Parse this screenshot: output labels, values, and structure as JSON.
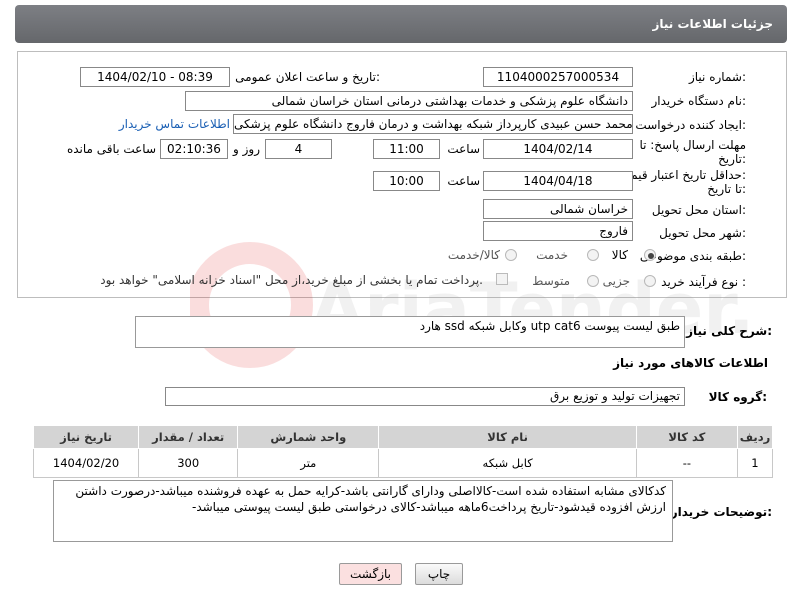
{
  "header": {
    "title": "جزئیات اطلاعات نیاز"
  },
  "fields": {
    "need_number_label": "شماره نیاز:",
    "need_number": "1104000257000534",
    "announce_label": "تاریخ و ساعت اعلان عمومی:",
    "announce_value": "1404/02/10 - 08:39",
    "buyer_org_label": "نام دستگاه خریدار:",
    "buyer_org": "دانشگاه علوم پزشکی و خدمات بهداشتی درمانی استان خراسان شمالی",
    "creator_label": "ایجاد کننده درخواست:",
    "creator": "محمد حسن عبیدی کارپرداز شبکه بهداشت و درمان فاروج دانشگاه علوم پزشکی",
    "contact_link": "اطلاعات تماس خریدار",
    "deadline_label_1": "مهلت ارسال پاسخ: تا",
    "deadline_label_2": "تاریخ:",
    "deadline_date": "1404/02/14",
    "time_label": "ساعت",
    "deadline_time": "11:00",
    "days_value": "4",
    "days_label": "روز و",
    "remaining_time": "02:10:36",
    "remaining_label": "ساعت باقی مانده",
    "min_price_label_1": "حداقل تاریخ اعتبار قیمت:",
    "min_price_label_2": "تا تاریخ:",
    "min_price_date": "1404/04/18",
    "min_price_time": "10:00",
    "province_label": "استان محل تحویل:",
    "province": "خراسان شمالی",
    "city_label": "شهر محل تحویل:",
    "city": "فاروج",
    "category_label": "طبقه بندی موضوعی:",
    "category_options": [
      "کالا",
      "خدمت",
      "کالا/خدمت"
    ],
    "purchase_type_label": "نوع فرآیند خرید :",
    "purchase_options": [
      "جزیی",
      "متوسط"
    ],
    "payment_note": "پرداخت تمام یا بخشی از مبلغ خرید،از محل \"اسناد خزانه اسلامی\" خواهد بود."
  },
  "description": {
    "label": "شرح کلی نیاز:",
    "text": "هارد ssd وکابل شبکه utp cat6 طبق لیست پیوست"
  },
  "goods": {
    "section_title": "اطلاعات کالاهای مورد نیاز",
    "group_label": "گروه کالا:",
    "group_value": "تجهیزات تولید و توزیع برق",
    "columns": [
      "ردیف",
      "کد کالا",
      "نام کالا",
      "واحد شمارش",
      "تعداد / مقدار",
      "تاریخ نیاز"
    ],
    "rows": [
      {
        "row": "1",
        "code": "--",
        "name": "کابل شبکه",
        "unit": "متر",
        "qty": "300",
        "date": "1404/02/20"
      }
    ]
  },
  "buyer_notes": {
    "label": "توضیحات خریدار:",
    "text": "کدکالای مشابه استفاده شده است-کالااصلی ودارای گارانتی باشد-کرایه حمل به عهده فروشنده میباشد-درصورت داشتن ارزش افزوده قیدشود-تاریخ پرداخت6ماهه میباشد-کالای درخواستی طبق لیست پیوستی میباشد-"
  },
  "buttons": {
    "print": "چاپ",
    "back": "بازگشت"
  },
  "watermark": {
    "text": "AriaTender.neT"
  },
  "colors": {
    "header_bg": "#6e7074",
    "link": "#1a5fb4",
    "back_button_bg": "#fbe0e0"
  }
}
